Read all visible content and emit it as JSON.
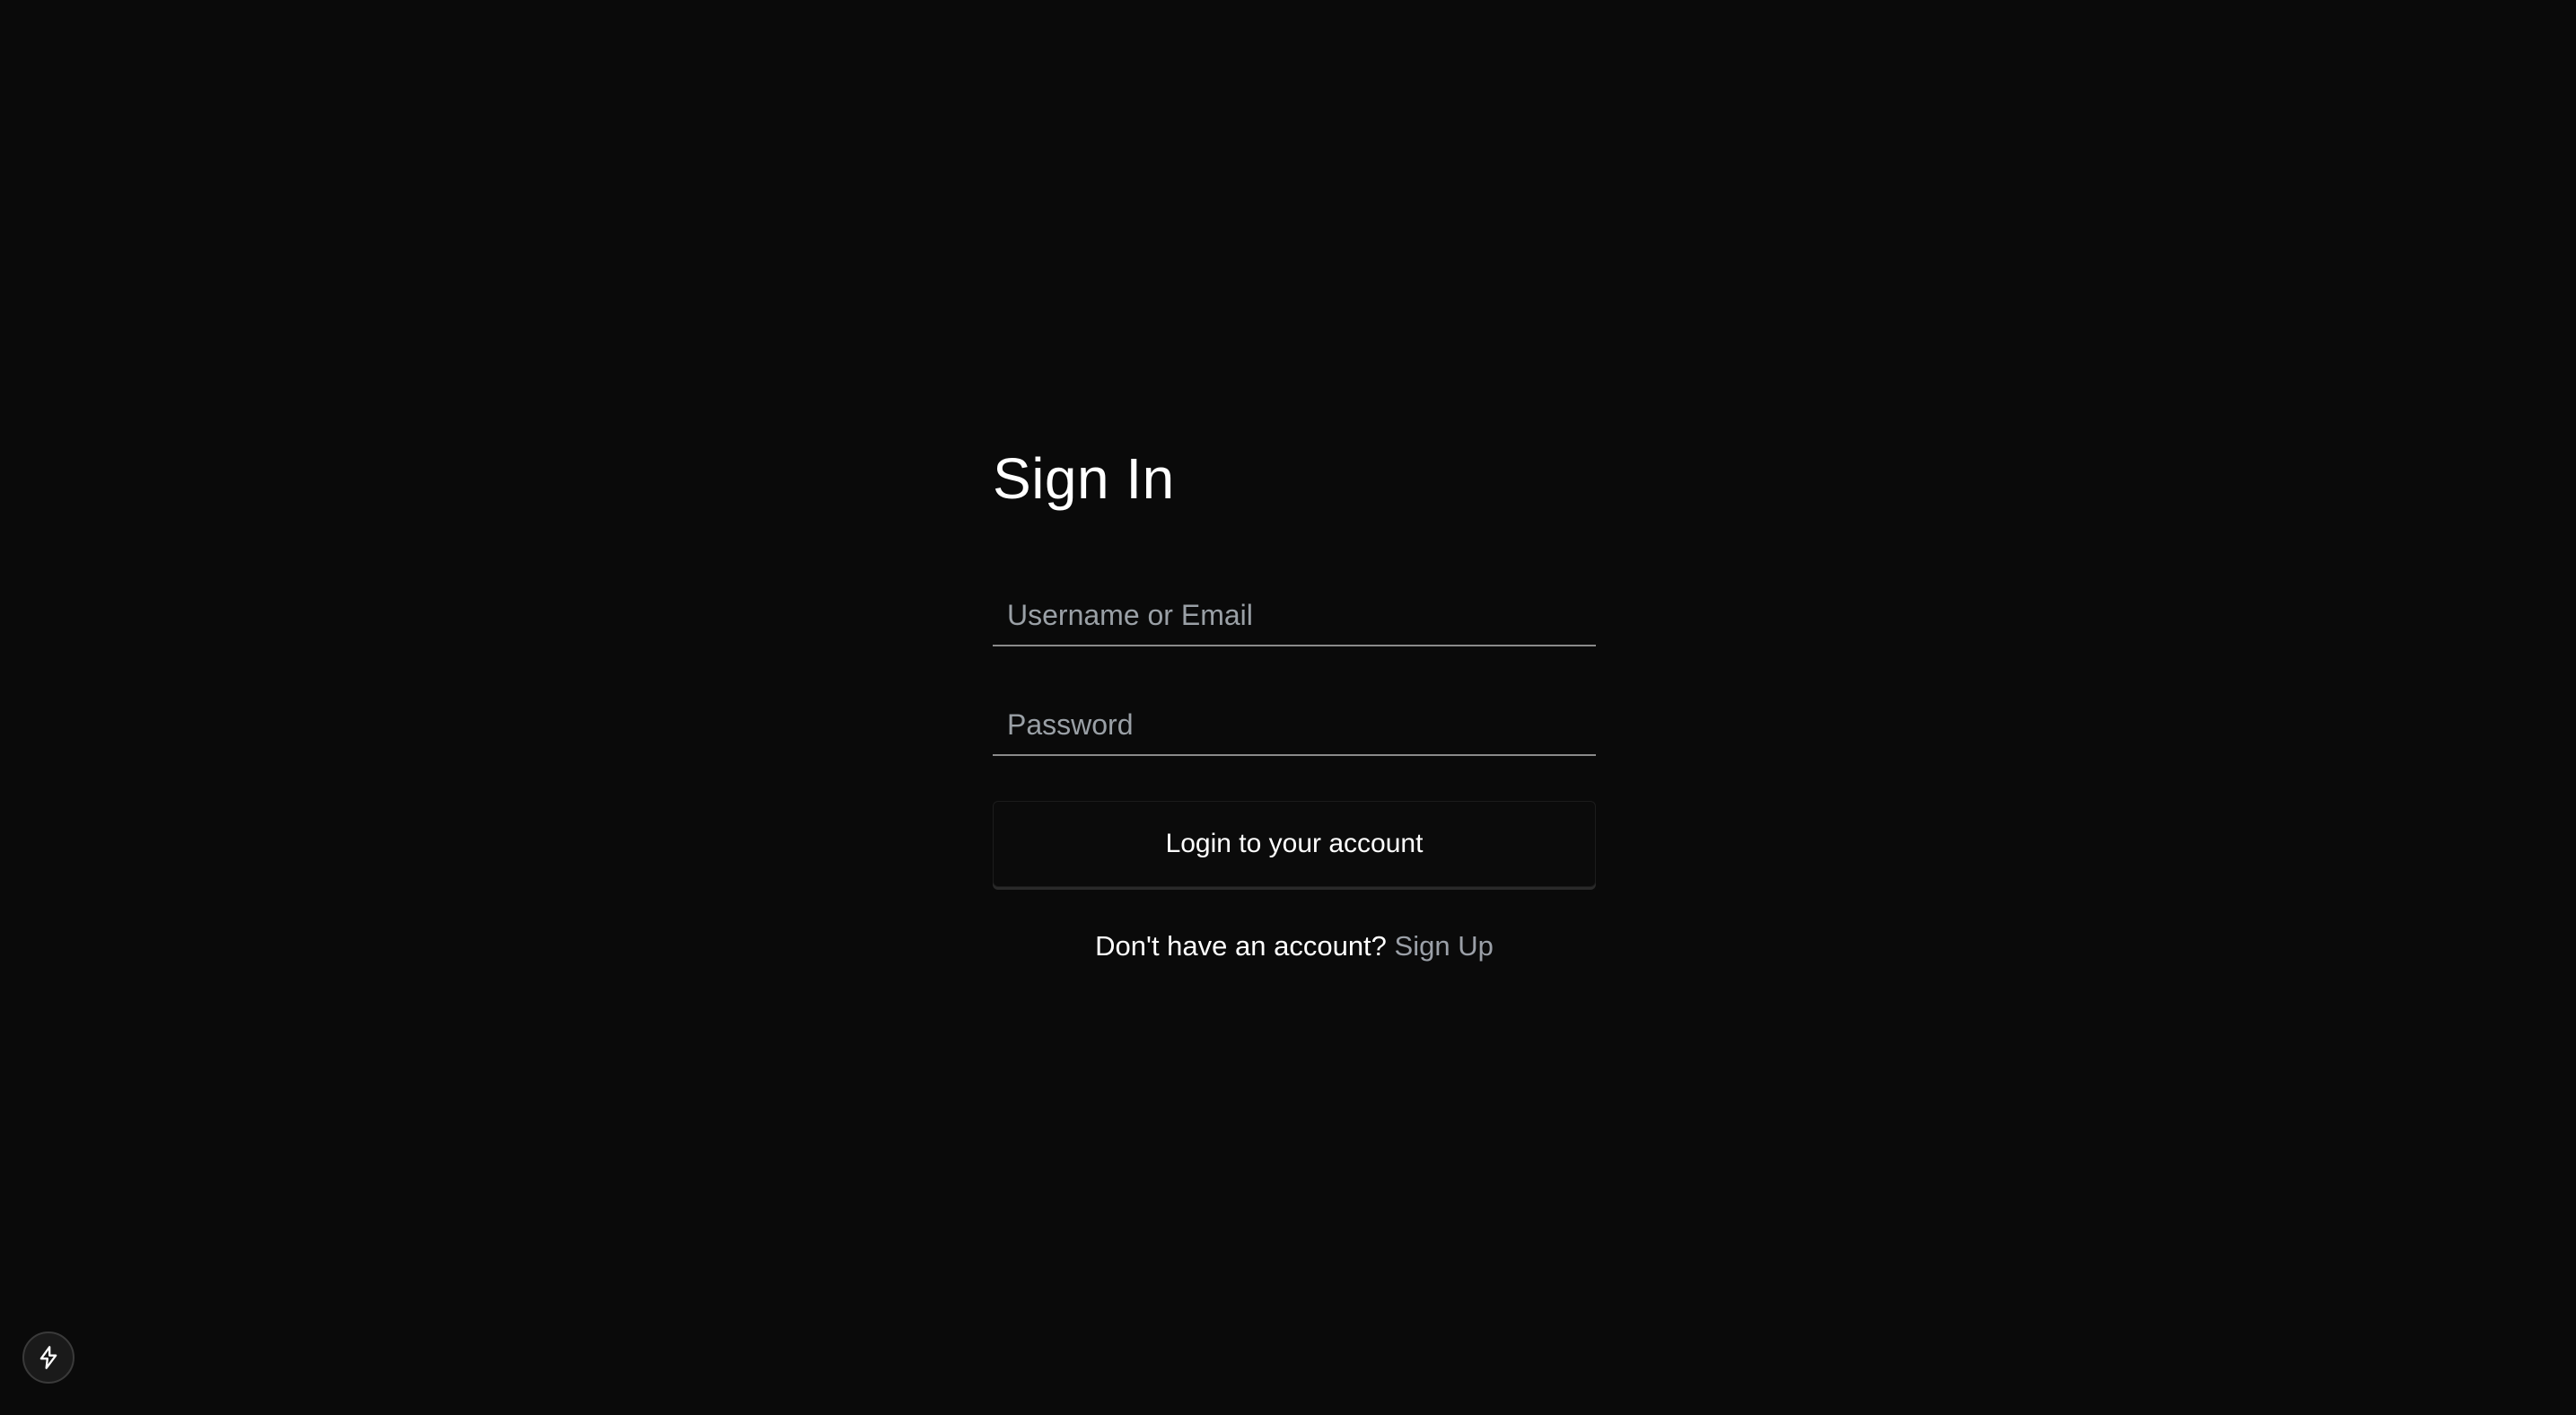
{
  "page": {
    "background_color": "#0a0a0a"
  },
  "signin": {
    "title": "Sign In",
    "username_placeholder": "Username or Email",
    "username_value": "",
    "password_placeholder": "Password",
    "password_value": "",
    "login_label": "Login to your account",
    "signup_prompt": "Don't have an account?",
    "signup_link_label": "Sign Up"
  },
  "corner_badge": {
    "icon": "lightning-bolt-icon"
  },
  "colors": {
    "text": "#ffffff",
    "muted": "#9aa0a6",
    "link": "#9ba0a8",
    "input_underline": "#8a8a8a"
  }
}
